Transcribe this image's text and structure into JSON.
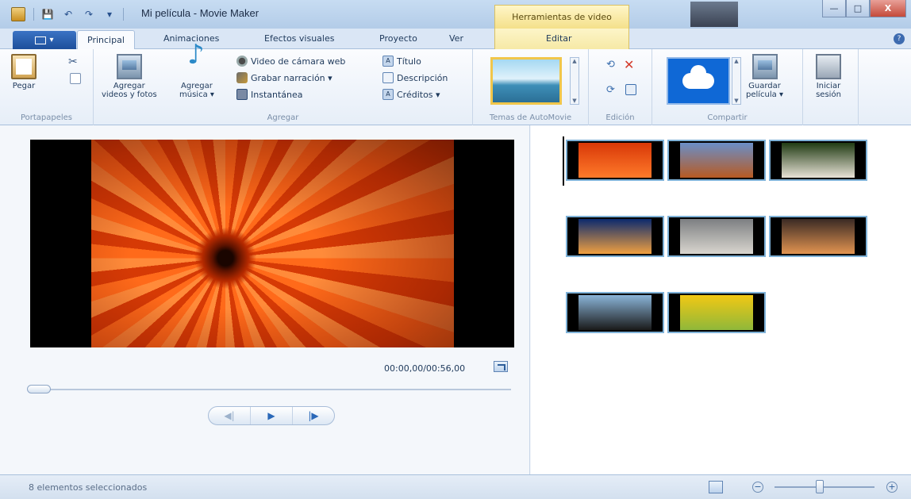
{
  "window": {
    "title": "Mi película - Movie Maker",
    "context_tab_group": "Herramientas de video",
    "controls": {
      "minimize": "—",
      "maximize": "□",
      "close": "X"
    }
  },
  "quick_access": {
    "save": "💾",
    "undo": "↶",
    "redo": "↷",
    "dropdown": "▾"
  },
  "tabs": {
    "file": "▾",
    "items": [
      "Principal",
      "Animaciones",
      "Efectos visuales",
      "Proyecto",
      "Ver",
      "Editar"
    ],
    "active": "Principal"
  },
  "ribbon": {
    "portapapeles": {
      "label": "Portapapeles",
      "paste": "Pegar"
    },
    "agregar": {
      "label": "Agregar",
      "add_videos": "Agregar\nvideos y fotos",
      "add_videos_line1": "Agregar",
      "add_videos_line2": "videos y fotos",
      "add_music_line1": "Agregar",
      "add_music_line2": "música ▾",
      "webcam": "Video de cámara web",
      "narration": "Grabar narración ▾",
      "snapshot": "Instantánea",
      "title": "Título",
      "caption": "Descripción",
      "credits": "Créditos ▾"
    },
    "temas": {
      "label": "Temas de AutoMovie"
    },
    "edicion": {
      "label": "Edición"
    },
    "compartir": {
      "label": "Compartir",
      "save_line1": "Guardar",
      "save_line2": "película ▾"
    },
    "sesion": {
      "line1": "Iniciar",
      "line2": "sesión"
    }
  },
  "preview": {
    "time": "00:00,00/00:56,00",
    "progress": 0
  },
  "transport": {
    "prev": "◀|",
    "play": "▶",
    "next": "|▶"
  },
  "storyboard": {
    "clips": [
      {
        "name": "flower-orange",
        "colors": [
          "#d83808",
          "#ff7a2a"
        ]
      },
      {
        "name": "desert",
        "colors": [
          "#6a8fc8",
          "#b85a22"
        ]
      },
      {
        "name": "hydrangea",
        "colors": [
          "#1f3a12",
          "#e8e2d6"
        ]
      },
      {
        "name": "jellyfish",
        "colors": [
          "#0b2a6e",
          "#f0a040"
        ]
      },
      {
        "name": "koala",
        "colors": [
          "#7d7f82",
          "#d9d6cf"
        ]
      },
      {
        "name": "lighthouse",
        "colors": [
          "#3a2a24",
          "#e29450"
        ]
      },
      {
        "name": "penguins",
        "colors": [
          "#8ab4d8",
          "#1a1a1a"
        ]
      },
      {
        "name": "tulips",
        "colors": [
          "#f2c814",
          "#8fb83a"
        ]
      }
    ]
  },
  "status": {
    "text": "8 elementos seleccionados",
    "zoom_out": "−",
    "zoom_in": "+",
    "zoom_level": 0.45
  }
}
